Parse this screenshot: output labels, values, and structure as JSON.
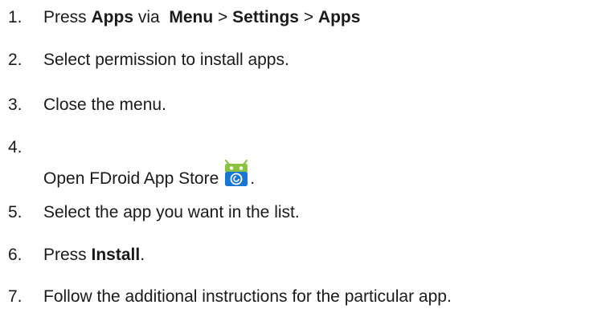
{
  "steps": [
    {
      "number": "1.",
      "parts": [
        "Press ",
        "Apps",
        " via  ",
        "Menu",
        " > ",
        "Settings",
        " > ",
        "Apps"
      ]
    },
    {
      "number": "2.",
      "text": "Select permission to install apps."
    },
    {
      "number": "3.",
      "text": "Close the menu."
    },
    {
      "number": "4.",
      "text": "Open FDroid App Store",
      "icon": "fdroid-app-icon",
      "after": "."
    },
    {
      "number": "5.",
      "text": "Select the app you want in the list."
    },
    {
      "number": "6.",
      "parts": [
        "Press ",
        "Install",
        "."
      ]
    },
    {
      "number": "7.",
      "text": "Follow the additional instructions for the particular app."
    }
  ],
  "colors": {
    "text": "#1a1a1a",
    "icon_green": "#8ac43f",
    "icon_blue": "#1976d2"
  }
}
